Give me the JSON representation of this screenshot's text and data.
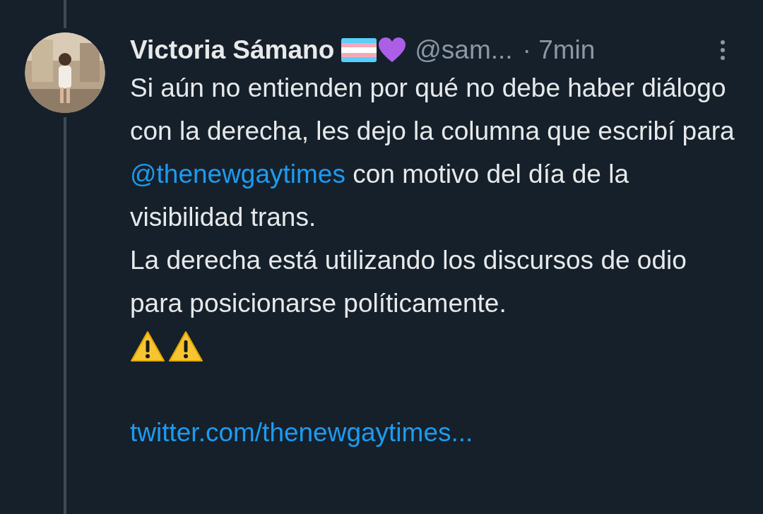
{
  "tweet": {
    "author": {
      "name": "Victoria Sámano",
      "handle": "@sam...",
      "time": "· 7min"
    },
    "paragraphs": [
      [
        {
          "kind": "text",
          "text": "Si aún no entienden por qué no debe haber diálogo con la derecha, les dejo la columna que escribí para "
        },
        {
          "kind": "mention",
          "text": "@thenewgaytimes"
        },
        {
          "kind": "text",
          "text": " con motivo del día de la visibilidad trans."
        }
      ],
      [
        {
          "kind": "text",
          "text": "La derecha está utilizando los discursos de odio para posicionarse políticamente."
        }
      ]
    ],
    "link": "twitter.com/thenewgaytimes..."
  }
}
